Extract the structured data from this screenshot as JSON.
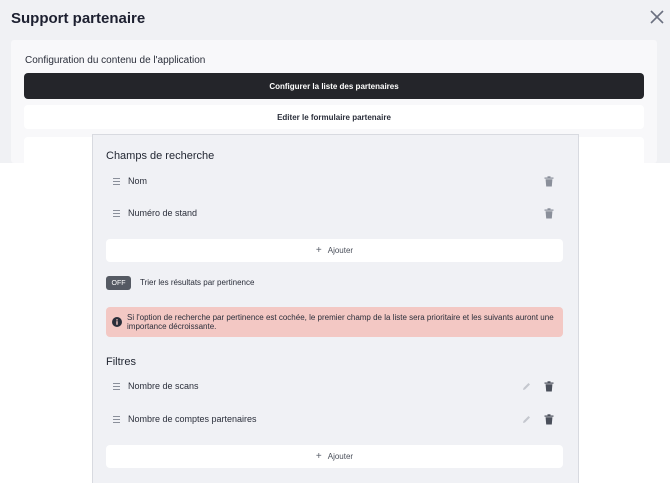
{
  "modal": {
    "title": "Support partenaire",
    "close_icon": "close-icon"
  },
  "config": {
    "label": "Configuration du contenu de l'application",
    "primary_button": "Configurer la liste des partenaires",
    "secondary_button": "Editer le formulaire partenaire"
  },
  "search_fields": {
    "title": "Champs de recherche",
    "items": [
      {
        "label": "Nom"
      },
      {
        "label": "Numéro de stand"
      }
    ],
    "add_label": "Ajouter"
  },
  "relevance": {
    "toggle_state": "OFF",
    "label": "Trier les résultats par pertinence",
    "alert": "Si l'option de recherche par pertinence est cochée, le premier champ de la liste sera prioritaire et les suivants auront une importance décroissante."
  },
  "filters": {
    "title": "Filtres",
    "items": [
      {
        "label": "Nombre de scans"
      },
      {
        "label": "Nombre de comptes partenaires"
      }
    ],
    "add_label": "Ajouter"
  },
  "colors": {
    "dark_button": "#24252a",
    "alert_bg": "#f3c8c4",
    "toggle_bg": "#555a63"
  }
}
